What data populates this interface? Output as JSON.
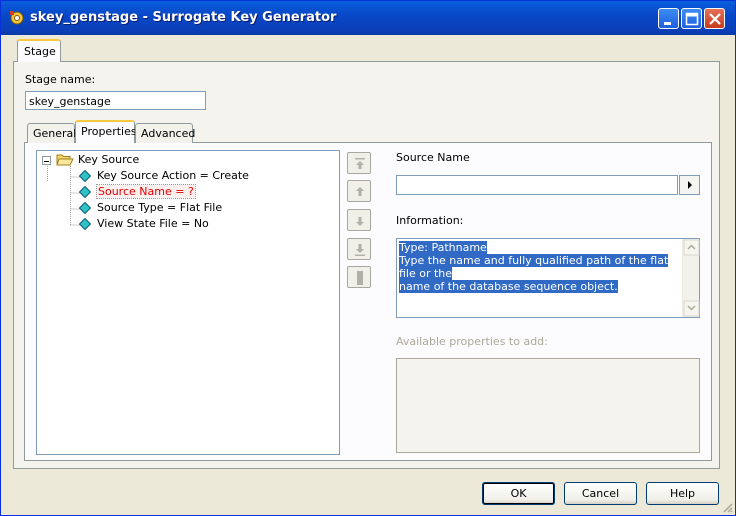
{
  "window": {
    "title": "skey_genstage - Surrogate Key Generator"
  },
  "outer_tab": {
    "label": "Stage"
  },
  "stage_name": {
    "label": "Stage name:",
    "value": "skey_genstage"
  },
  "tabs": [
    {
      "label": "General",
      "active": false
    },
    {
      "label": "Properties",
      "active": true
    },
    {
      "label": "Advanced",
      "active": false
    }
  ],
  "tree": {
    "root": "Key Source",
    "items": [
      "Key Source Action = Create",
      "Source Name = ?",
      "Source Type = Flat File",
      "View State File = No"
    ]
  },
  "source_name": {
    "label": "Source Name",
    "value": ""
  },
  "information": {
    "label": "Information:",
    "line1": "Type: Pathname",
    "line2": "Type the name and fully qualified path of the flat file or the",
    "line3": "name of the database sequence object."
  },
  "available": {
    "label": "Available properties to add:"
  },
  "buttons": {
    "ok": "OK",
    "cancel": "Cancel",
    "help": "Help"
  },
  "colors": {
    "titlebar": "#0848c8",
    "selected_text": "#e00000",
    "highlight": "#316ac5",
    "tab_accent": "#ffc83c"
  }
}
